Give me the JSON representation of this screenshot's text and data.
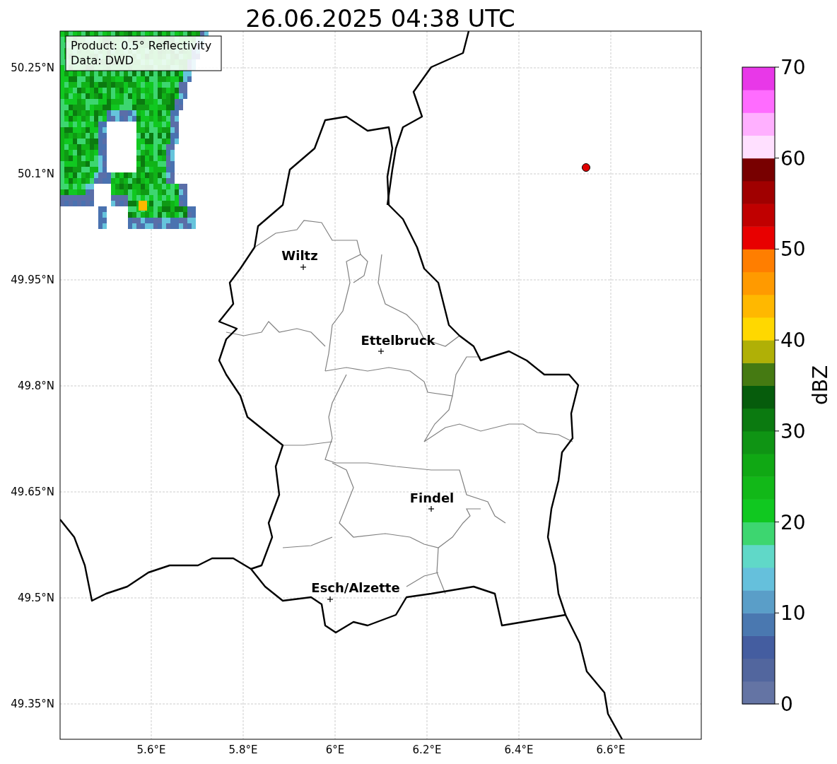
{
  "title": "26.06.2025 04:38 UTC",
  "info_box": [
    "Product: 0.5° Reflectivity",
    "Data: DWD"
  ],
  "y_ticks": [
    "50.25°N",
    "50.1°N",
    "49.95°N",
    "49.8°N",
    "49.65°N",
    "49.5°N",
    "49.35°N"
  ],
  "x_ticks": [
    "5.6°E",
    "5.8°E",
    "6°E",
    "6.2°E",
    "6.4°E",
    "6.6°E"
  ],
  "cities": [
    {
      "name": "Wiltz"
    },
    {
      "name": "Ettelbruck"
    },
    {
      "name": "Findel"
    },
    {
      "name": "Esch/Alzette"
    }
  ],
  "colorbar": {
    "label": "dBZ",
    "ticks": [
      "70",
      "60",
      "50",
      "40",
      "30",
      "20",
      "10",
      "0"
    ],
    "bins": [
      {
        "color": "#6474a4"
      },
      {
        "color": "#52669e"
      },
      {
        "color": "#445da0"
      },
      {
        "color": "#4a78b0"
      },
      {
        "color": "#5a9ec8"
      },
      {
        "color": "#65c0dc"
      },
      {
        "color": "#60d8c8"
      },
      {
        "color": "#3dd670"
      },
      {
        "color": "#10c820"
      },
      {
        "color": "#12b818"
      },
      {
        "color": "#10a814"
      },
      {
        "color": "#0f9414"
      },
      {
        "color": "#0b7a10"
      },
      {
        "color": "#065c0c"
      },
      {
        "color": "#457a12"
      },
      {
        "color": "#b0b006"
      },
      {
        "color": "#ffd800"
      },
      {
        "color": "#ffb800"
      },
      {
        "color": "#ff9a00"
      },
      {
        "color": "#ff7e00"
      },
      {
        "color": "#e80000"
      },
      {
        "color": "#c00000"
      },
      {
        "color": "#a00000"
      },
      {
        "color": "#780000"
      },
      {
        "color": "#ffe0ff"
      },
      {
        "color": "#ffb0ff"
      },
      {
        "color": "#ff6cff"
      },
      {
        "color": "#e838e8"
      }
    ]
  }
}
